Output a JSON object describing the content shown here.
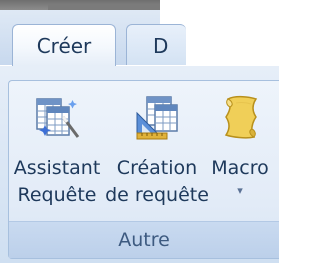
{
  "tabs": [
    {
      "label": "Créer",
      "active": true
    },
    {
      "label": "D",
      "active": false
    }
  ],
  "group": {
    "label": "Autre",
    "buttons": [
      {
        "id": "assistant",
        "line1": "Assistant",
        "line2": "Requête",
        "icon": "query-wizard-icon"
      },
      {
        "id": "creation",
        "line1": "Création",
        "line2": "de requête",
        "icon": "query-design-icon"
      },
      {
        "id": "macro",
        "line1": "Macro",
        "dropdown_glyph": "▾",
        "icon": "macro-scroll-icon"
      }
    ]
  },
  "colors": {
    "ribbon_bg": "#dbe7f5",
    "text": "#1e395b",
    "group_label_text": "#3d5a80",
    "macro_scroll": "#e8c547"
  }
}
